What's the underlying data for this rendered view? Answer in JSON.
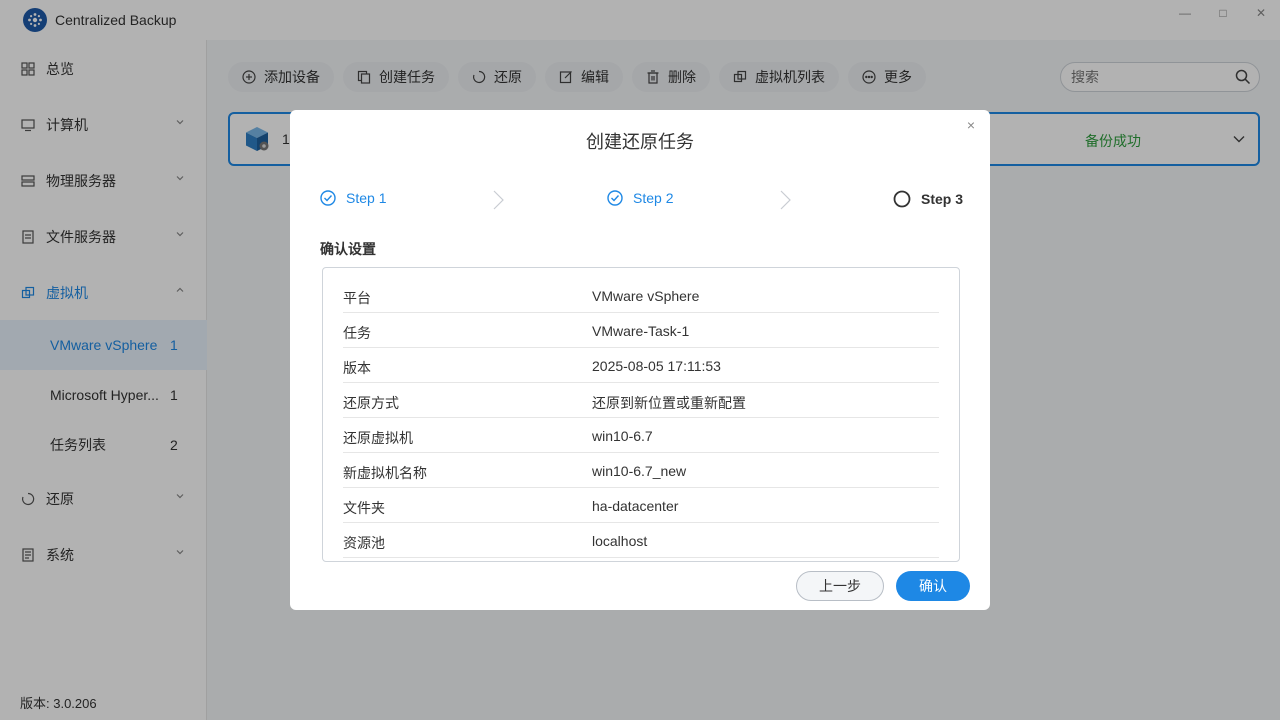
{
  "app": {
    "title": "Centralized Backup",
    "version_text": "版本: 3.0.206"
  },
  "window_controls": {
    "minimize": "—",
    "maximize": "□",
    "close": "✕"
  },
  "sidebar": {
    "items": [
      {
        "label": "总览",
        "icon": "grid-icon",
        "expanded": false
      },
      {
        "label": "计算机",
        "icon": "monitor-icon",
        "expanded": false
      },
      {
        "label": "物理服务器",
        "icon": "server-icon",
        "expanded": false
      },
      {
        "label": "文件服务器",
        "icon": "file-server-icon",
        "expanded": false
      },
      {
        "label": "虚拟机",
        "icon": "vm-icon",
        "expanded": true,
        "active": true
      },
      {
        "label": "还原",
        "icon": "restore-icon",
        "expanded": false
      },
      {
        "label": "系统",
        "icon": "system-icon",
        "expanded": false
      }
    ],
    "sub_items": [
      {
        "label": "VMware vSphere",
        "count": "1",
        "selected": true
      },
      {
        "label": "Microsoft Hyper...",
        "count": "1"
      },
      {
        "label": "任务列表",
        "count": "2"
      }
    ]
  },
  "toolbar": {
    "buttons": [
      {
        "label": "添加设备",
        "icon": "plus-circle-icon"
      },
      {
        "label": "创建任务",
        "icon": "copy-icon"
      },
      {
        "label": "还原",
        "icon": "restore-icon"
      },
      {
        "label": "编辑",
        "icon": "edit-icon"
      },
      {
        "label": "删除",
        "icon": "trash-icon"
      },
      {
        "label": "虚拟机列表",
        "icon": "vm-list-icon"
      },
      {
        "label": "更多",
        "icon": "more-icon"
      }
    ],
    "search_placeholder": "搜索"
  },
  "device_card": {
    "name": "1(",
    "status": "备份成功"
  },
  "modal": {
    "title": "创建还原任务",
    "close": "×",
    "steps": [
      {
        "label": "Step 1",
        "state": "done"
      },
      {
        "label": "Step 2",
        "state": "done"
      },
      {
        "label": "Step 3",
        "state": "current"
      }
    ],
    "section_title": "确认设置",
    "summary": [
      {
        "key": "平台",
        "value": "VMware vSphere"
      },
      {
        "key": "任务",
        "value": "VMware-Task-1"
      },
      {
        "key": "版本",
        "value": "2025-08-05 17:11:53"
      },
      {
        "key": "还原方式",
        "value": "还原到新位置或重新配置"
      },
      {
        "key": "还原虚拟机",
        "value": "win10-6.7"
      },
      {
        "key": "新虚拟机名称",
        "value": "win10-6.7_new"
      },
      {
        "key": "文件夹",
        "value": "ha-datacenter"
      },
      {
        "key": "资源池",
        "value": "localhost"
      }
    ],
    "prev_label": "上一步",
    "confirm_label": "确认"
  },
  "colors": {
    "accent": "#1e88e5",
    "success": "#2e9e3e"
  }
}
